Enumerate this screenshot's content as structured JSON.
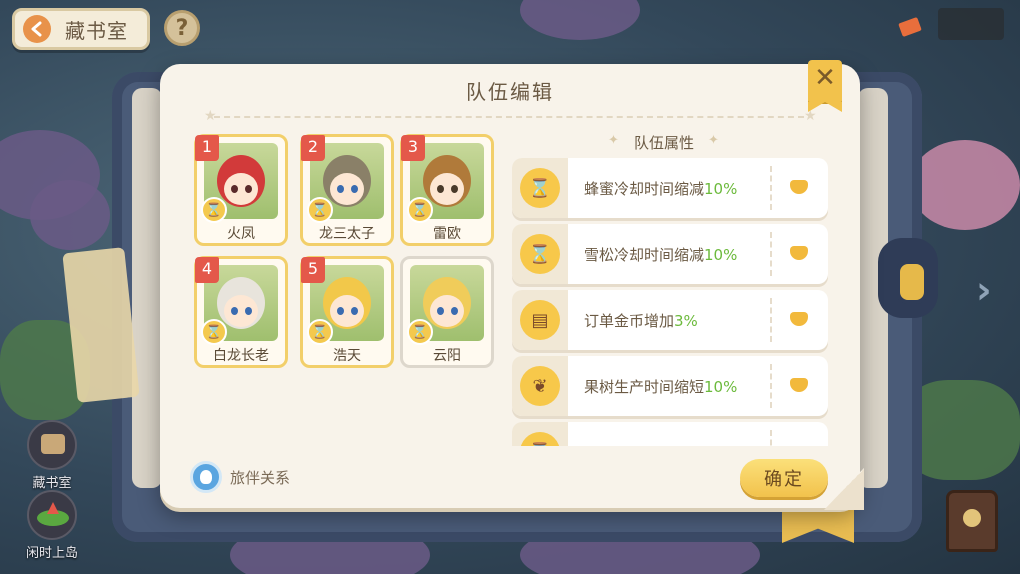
{
  "header": {
    "back_label": "藏书室",
    "help_label": "?"
  },
  "side": {
    "library_label": "藏书室",
    "island_label": "闲时上岛"
  },
  "dialog": {
    "title": "队伍编辑",
    "close_label": "✕",
    "heroes": [
      {
        "slot": "1",
        "name": "火凤",
        "hair": "#d23a3a",
        "eye": "#5a2a2a",
        "active": true
      },
      {
        "slot": "2",
        "name": "龙三太子",
        "hair": "#8a8068",
        "eye": "#3a6bb0",
        "active": true
      },
      {
        "slot": "3",
        "name": "雷欧",
        "hair": "#b07a3a",
        "eye": "#4a3a2a",
        "active": true
      },
      {
        "slot": "4",
        "name": "白龙长老",
        "hair": "#e8e4dc",
        "eye": "#3a6bb0",
        "active": true
      },
      {
        "slot": "5",
        "name": "浩天",
        "hair": "#f2c84a",
        "eye": "#3a6bb0",
        "active": true
      },
      {
        "slot": "",
        "name": "云阳",
        "hair": "#f0cc5a",
        "eye": "#3a6bb0",
        "active": false
      }
    ],
    "attributes_title": "队伍属性",
    "attributes": [
      {
        "text": "蜂蜜冷却时间缩减",
        "value": "10%",
        "icon": "hourglass-icon"
      },
      {
        "text": "雪松冷却时间缩减",
        "value": "10%",
        "icon": "hourglass-icon"
      },
      {
        "text": "订单金币增加",
        "value": "3%",
        "icon": "clipboard-icon"
      },
      {
        "text": "果树生产时间缩短",
        "value": "10%",
        "icon": "sprout-icon"
      },
      {
        "text": "",
        "value": "",
        "icon": "hourglass-icon"
      }
    ],
    "companion_label": "旅伴关系",
    "confirm_label": "确定"
  },
  "colors": {
    "accent": "#f2c24c",
    "value_green": "#6cba3c",
    "slot_red": "#e4584a"
  }
}
